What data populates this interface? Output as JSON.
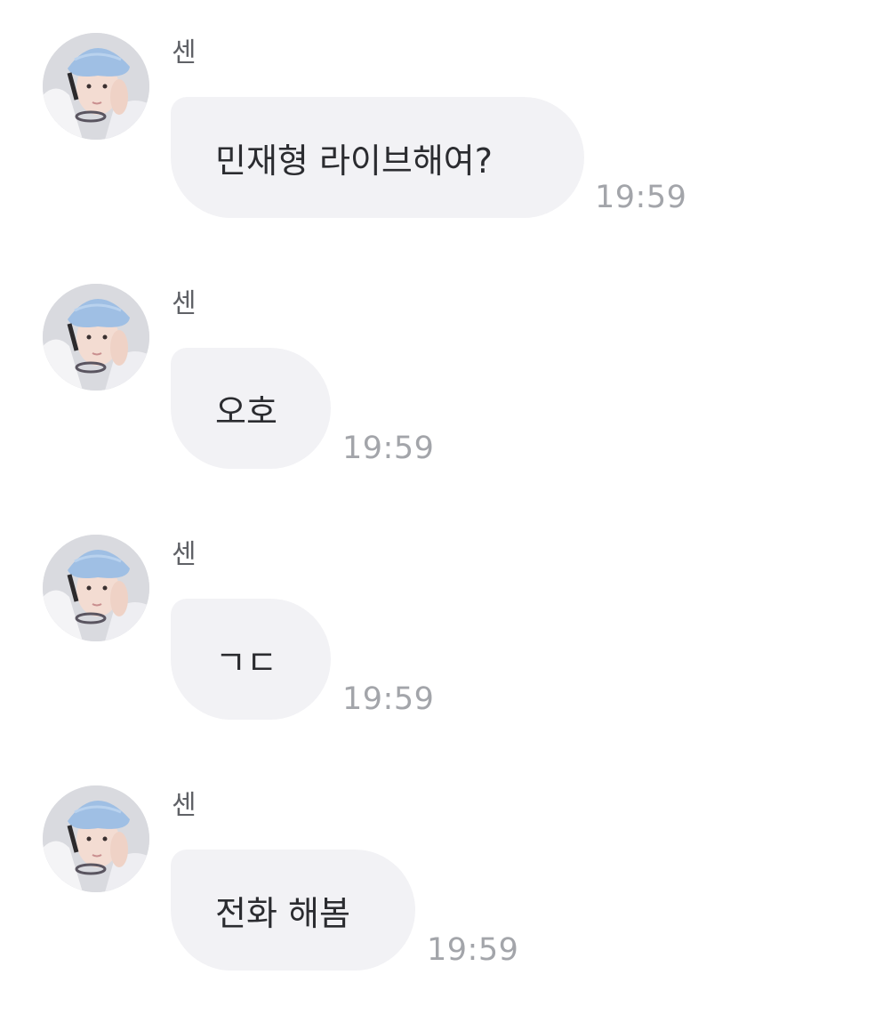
{
  "messages": [
    {
      "sender": "센",
      "text": "민재형 라이브해여?",
      "time": "19:59"
    },
    {
      "sender": "센",
      "text": "오호",
      "time": "19:59"
    },
    {
      "sender": "센",
      "text": "ㄱㄷ",
      "time": "19:59"
    },
    {
      "sender": "센",
      "text": "전화 해봄",
      "time": "19:59"
    }
  ]
}
